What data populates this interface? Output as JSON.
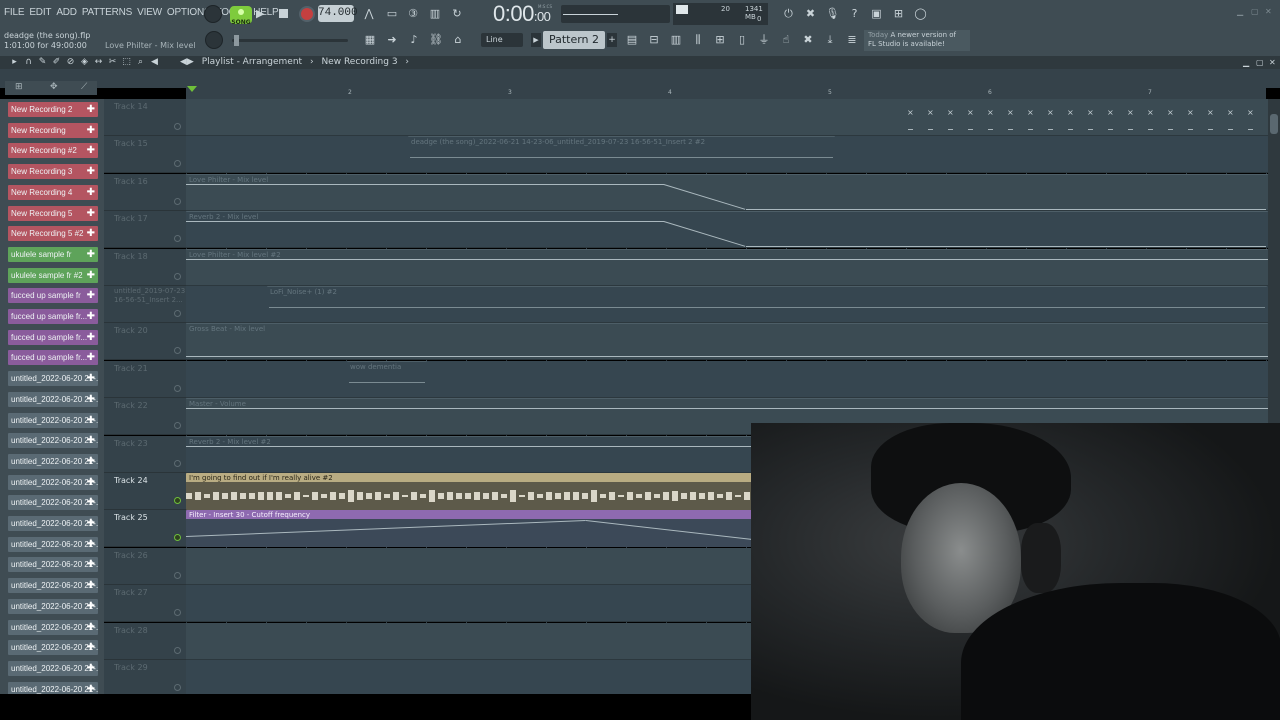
{
  "menu": [
    "FILE",
    "EDIT",
    "ADD",
    "PATTERNS",
    "VIEW",
    "OPTIONS",
    "TOOLS",
    "HELP"
  ],
  "transport": {
    "mode": "SONG",
    "tempo": "74.000",
    "time": "0:00",
    "time_sub": ":00",
    "time_label": "M:S:CS"
  },
  "monitor": {
    "cpu": "20",
    "memory": "1341 MB",
    "polyphony": "0"
  },
  "hint": {
    "file": "deadge (the song).flp",
    "time": "1:01:00 for 49:00:00",
    "plugin": "Love Philter - Mix level"
  },
  "snap": "Line",
  "pattern": "Pattern 2",
  "news": {
    "when": "Today",
    "text": "A newer version of FL Studio is available!"
  },
  "playlist": {
    "title": "Playlist - Arrangement",
    "sep": "›",
    "pattern": "New Recording 3",
    "sep2": "›"
  },
  "ruler": [
    "2",
    "3",
    "4",
    "5",
    "6",
    "7"
  ],
  "clip_list": [
    {
      "label": "New Recording 2",
      "color": "#b45561"
    },
    {
      "label": "New Recording",
      "color": "#b45561"
    },
    {
      "label": "New Recording #2",
      "color": "#b45561"
    },
    {
      "label": "New Recording 3",
      "color": "#b45561"
    },
    {
      "label": "New Recording 4",
      "color": "#b45561"
    },
    {
      "label": "New Recording 5",
      "color": "#b45561"
    },
    {
      "label": "New Recording 5 #2",
      "color": "#b45561"
    },
    {
      "label": "ukulele sample fr",
      "color": "#5ea35a"
    },
    {
      "label": "ukulele sample fr #2",
      "color": "#5ea35a"
    },
    {
      "label": "fucced up sample fr",
      "color": "#8a5c9c"
    },
    {
      "label": "fucced up sample fr...",
      "color": "#8a5c9c"
    },
    {
      "label": "fucced up sample fr...",
      "color": "#8a5c9c"
    },
    {
      "label": "fucced up sample fr...",
      "color": "#8a5c9c"
    },
    {
      "label": "untitled_2022-06-20 21-...",
      "color": "#5a6a74"
    },
    {
      "label": "untitled_2022-06-20 21-...",
      "color": "#5a6a74"
    },
    {
      "label": "untitled_2022-06-20 21-...",
      "color": "#5a6a74"
    },
    {
      "label": "untitled_2022-06-20 21-...",
      "color": "#5a6a74"
    },
    {
      "label": "untitled_2022-06-20 22-...",
      "color": "#5a6a74"
    },
    {
      "label": "untitled_2022-06-20 22-...",
      "color": "#5a6a74"
    },
    {
      "label": "untitled_2022-06-20 22-...",
      "color": "#5a6a74"
    },
    {
      "label": "untitled_2022-06-20 22-...",
      "color": "#5a6a74"
    },
    {
      "label": "untitled_2022-06-20 22-...",
      "color": "#5a6a74"
    },
    {
      "label": "untitled_2022-06-20 22-...",
      "color": "#5a6a74"
    },
    {
      "label": "untitled_2022-06-20 22-...",
      "color": "#5a6a74"
    },
    {
      "label": "untitled_2022-06-20 22-...",
      "color": "#5a6a74"
    },
    {
      "label": "untitled_2022-06-20 22-...",
      "color": "#5a6a74"
    },
    {
      "label": "untitled_2022-06-20 22-...",
      "color": "#5a6a74"
    },
    {
      "label": "untitled_2022-06-20 22-...",
      "color": "#5a6a74"
    },
    {
      "label": "untitled_2022-06-20 22-...",
      "color": "#5a6a74"
    }
  ],
  "tracks": [
    {
      "name": "Track 14",
      "active": false,
      "clip": ""
    },
    {
      "name": "Track 15",
      "active": false,
      "clip": "deadge (the song)_2022-06-21 14-23-06_untitled_2019-07-23 16-56-51_Insert 2 #2"
    },
    {
      "name": "Track 16",
      "active": false,
      "clip": "Love Philter - Mix level"
    },
    {
      "name": "Track 17",
      "active": false,
      "clip": "Reverb 2 - Mix level"
    },
    {
      "name": "Track 18",
      "active": false,
      "clip": "Love Philter - Mix level #2"
    },
    {
      "name": "untitled_2019-07-23 16-56-51_Insert 2...",
      "active": false,
      "clip": "LoFi_Noise+ (1) #2"
    },
    {
      "name": "Track 20",
      "active": false,
      "clip": "Gross Beat - Mix level"
    },
    {
      "name": "Track 21",
      "active": false,
      "clip": "wow dementia"
    },
    {
      "name": "Track 22",
      "active": false,
      "clip": "Master - Volume"
    },
    {
      "name": "Track 23",
      "active": false,
      "clip": "Reverb 2 - Mix level #2"
    },
    {
      "name": "Track 24",
      "active": true,
      "clip": "I'm going to find out if I'm really alive #2"
    },
    {
      "name": "Track 25",
      "active": true,
      "clip": "Filter - Insert 30 - Cutoff frequency"
    },
    {
      "name": "Track 26",
      "active": false,
      "clip": ""
    },
    {
      "name": "Track 27",
      "active": false,
      "clip": ""
    },
    {
      "name": "Track 28",
      "active": false,
      "clip": ""
    },
    {
      "name": "Track 29",
      "active": false,
      "clip": ""
    }
  ]
}
